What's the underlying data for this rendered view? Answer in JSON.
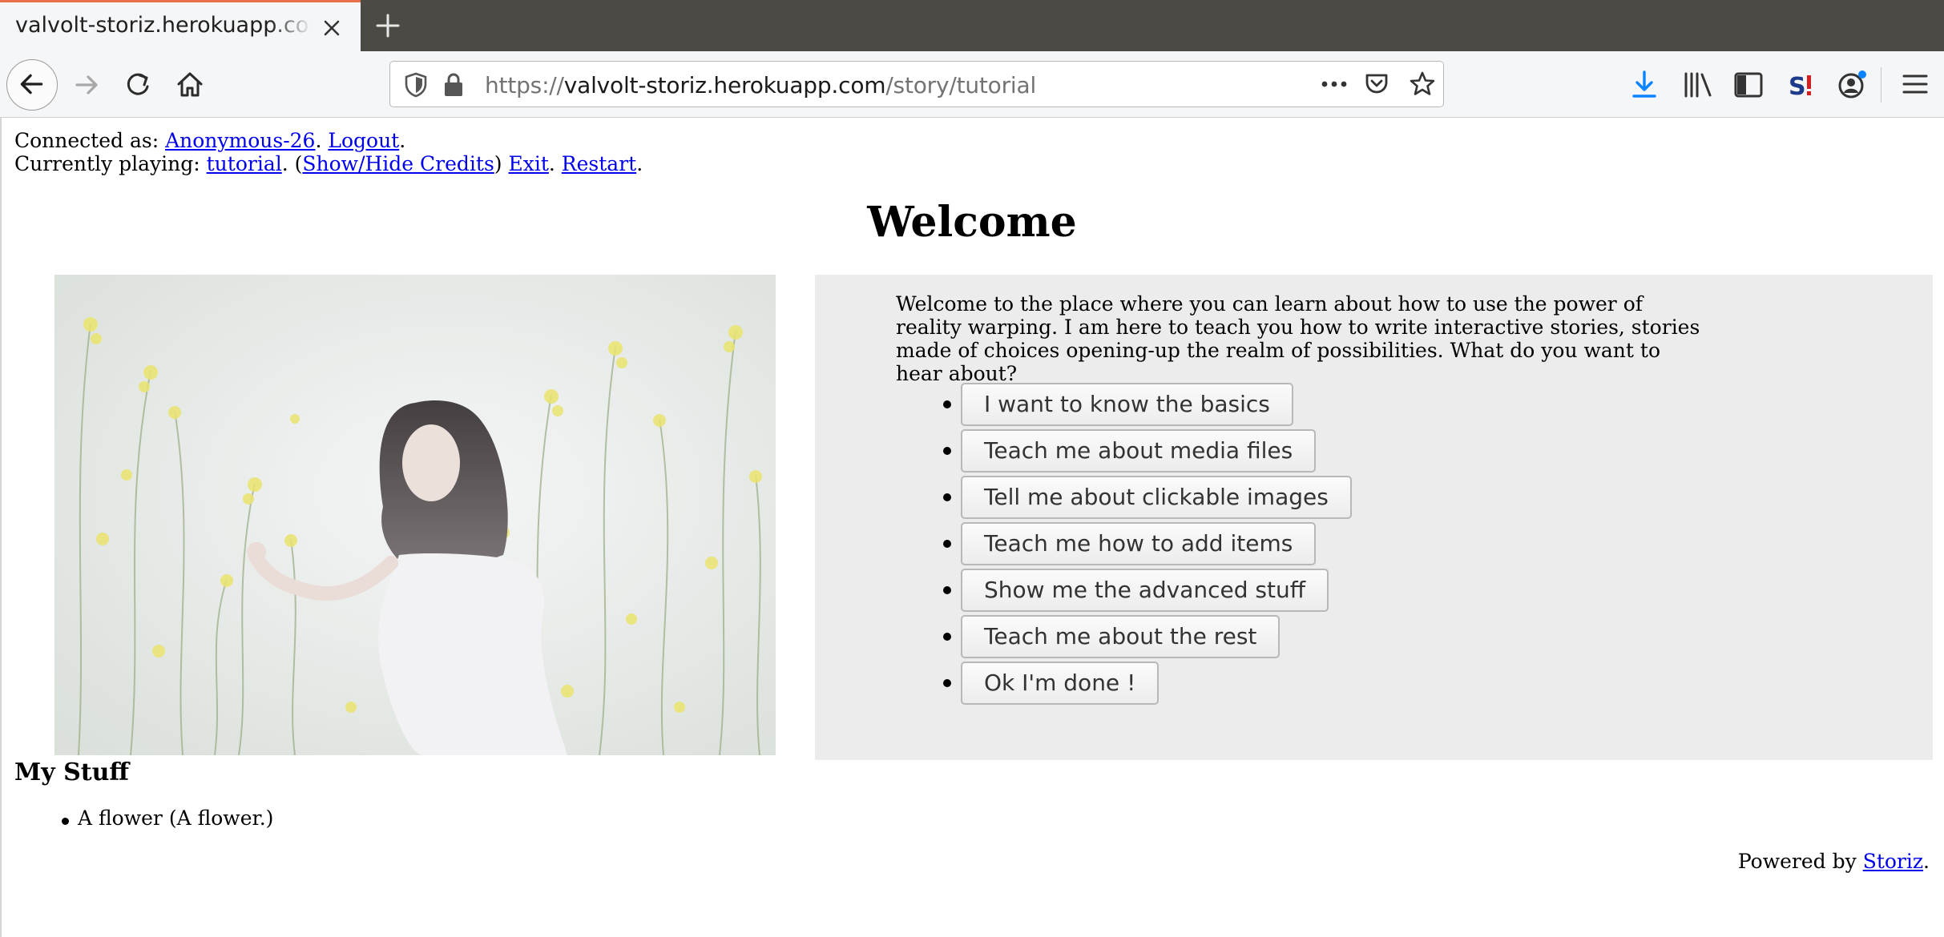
{
  "browser": {
    "tab_title": "valvolt-storiz.herokuapp.com",
    "url_scheme": "https://",
    "url_host": "valvolt-storiz.herokuapp.com",
    "url_path": "/story/tutorial"
  },
  "session": {
    "connected_prefix": "Connected as: ",
    "username": "Anonymous-26",
    "logout_label": "Logout",
    "playing_prefix": "Currently playing: ",
    "story_name": "tutorial",
    "credits_label": "Show/Hide Credits",
    "exit_label": "Exit",
    "restart_label": "Restart"
  },
  "story": {
    "title": "Welcome",
    "text": "Welcome to the place where you can learn about how to use the power of reality warping. I am here to teach you how to write interactive stories, stories made of choices opening-up the realm of possibilities. What do you want to hear about?",
    "choices": [
      "I want to know the basics",
      "Teach me about media files",
      "Tell me about clickable images",
      "Teach me how to add items",
      "Show me the advanced stuff",
      "Teach me about the rest",
      "Ok I'm done !"
    ]
  },
  "inventory": {
    "heading": "My Stuff",
    "items": [
      "A flower (A flower.)"
    ]
  },
  "footer": {
    "prefix": "Powered by ",
    "link": "Storiz"
  },
  "icons": {
    "toolbar": [
      "back-arrow-icon",
      "forward-arrow-icon",
      "reload-icon",
      "home-icon",
      "shield-icon",
      "lock-icon",
      "page-actions-icon",
      "pocket-icon",
      "bookmark-star-icon",
      "download-icon",
      "library-icon",
      "sidebar-icon",
      "storiz-extension-icon",
      "account-icon",
      "hamburger-menu-icon"
    ]
  },
  "colors": {
    "tabbar": "#4b4a45",
    "tab_accent": "#e8714a",
    "download_icon": "#0a84ff",
    "link": "#0000ee",
    "story_panel": "#ececec"
  }
}
